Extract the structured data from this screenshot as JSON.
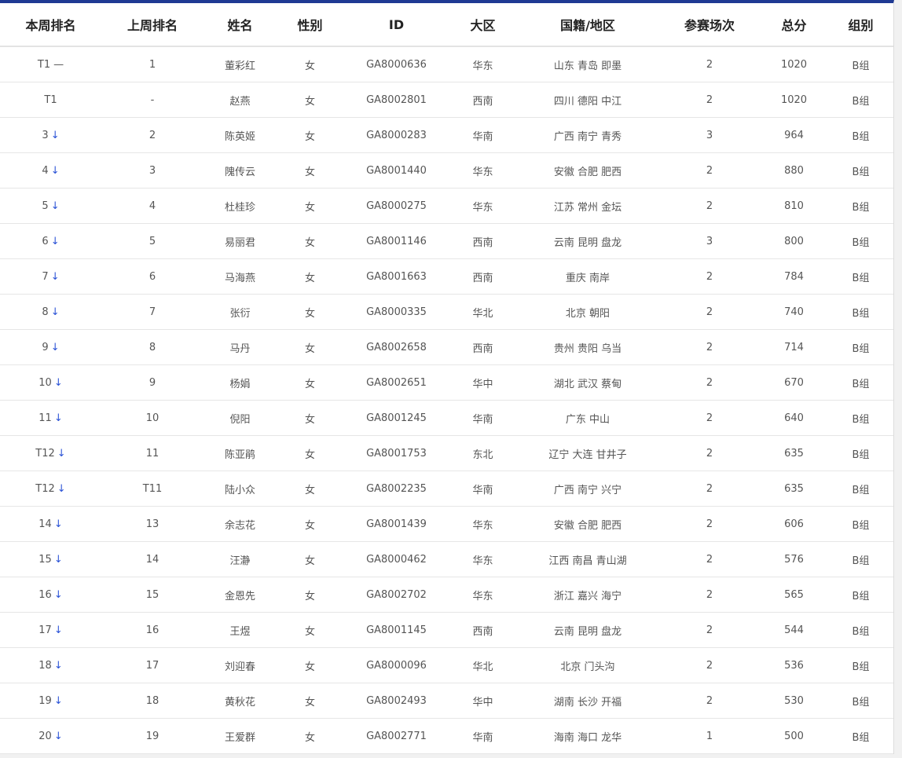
{
  "columns": [
    "本周排名",
    "上周排名",
    "姓名",
    "性别",
    "ID",
    "大区",
    "国籍/地区",
    "参赛场次",
    "总分",
    "组别"
  ],
  "rows": [
    {
      "rank": "T1",
      "trend": "—",
      "prev": "1",
      "name": "董彩红",
      "gender": "女",
      "id": "GA8000636",
      "region": "华东",
      "location": "山东 青岛 即墨",
      "games": "2",
      "score": "1020",
      "group": "B组"
    },
    {
      "rank": "T1",
      "trend": "",
      "prev": "-",
      "name": "赵燕",
      "gender": "女",
      "id": "GA8002801",
      "region": "西南",
      "location": "四川 德阳 中江",
      "games": "2",
      "score": "1020",
      "group": "B组"
    },
    {
      "rank": "3",
      "trend": "↓",
      "prev": "2",
      "name": "陈英姬",
      "gender": "女",
      "id": "GA8000283",
      "region": "华南",
      "location": "广西 南宁 青秀",
      "games": "3",
      "score": "964",
      "group": "B组"
    },
    {
      "rank": "4",
      "trend": "↓",
      "prev": "3",
      "name": "隗传云",
      "gender": "女",
      "id": "GA8001440",
      "region": "华东",
      "location": "安徽 合肥 肥西",
      "games": "2",
      "score": "880",
      "group": "B组"
    },
    {
      "rank": "5",
      "trend": "↓",
      "prev": "4",
      "name": "杜桂珍",
      "gender": "女",
      "id": "GA8000275",
      "region": "华东",
      "location": "江苏 常州 金坛",
      "games": "2",
      "score": "810",
      "group": "B组"
    },
    {
      "rank": "6",
      "trend": "↓",
      "prev": "5",
      "name": "易丽君",
      "gender": "女",
      "id": "GA8001146",
      "region": "西南",
      "location": "云南 昆明 盘龙",
      "games": "3",
      "score": "800",
      "group": "B组"
    },
    {
      "rank": "7",
      "trend": "↓",
      "prev": "6",
      "name": "马海燕",
      "gender": "女",
      "id": "GA8001663",
      "region": "西南",
      "location": "重庆 南岸",
      "games": "2",
      "score": "784",
      "group": "B组"
    },
    {
      "rank": "8",
      "trend": "↓",
      "prev": "7",
      "name": "张衍",
      "gender": "女",
      "id": "GA8000335",
      "region": "华北",
      "location": "北京 朝阳",
      "games": "2",
      "score": "740",
      "group": "B组"
    },
    {
      "rank": "9",
      "trend": "↓",
      "prev": "8",
      "name": "马丹",
      "gender": "女",
      "id": "GA8002658",
      "region": "西南",
      "location": "贵州 贵阳 乌当",
      "games": "2",
      "score": "714",
      "group": "B组"
    },
    {
      "rank": "10",
      "trend": "↓",
      "prev": "9",
      "name": "杨娟",
      "gender": "女",
      "id": "GA8002651",
      "region": "华中",
      "location": "湖北 武汉 蔡甸",
      "games": "2",
      "score": "670",
      "group": "B组"
    },
    {
      "rank": "11",
      "trend": "↓",
      "prev": "10",
      "name": "倪阳",
      "gender": "女",
      "id": "GA8001245",
      "region": "华南",
      "location": "广东 中山",
      "games": "2",
      "score": "640",
      "group": "B组"
    },
    {
      "rank": "T12",
      "trend": "↓",
      "prev": "11",
      "name": "陈亚鹃",
      "gender": "女",
      "id": "GA8001753",
      "region": "东北",
      "location": "辽宁 大连 甘井子",
      "games": "2",
      "score": "635",
      "group": "B组"
    },
    {
      "rank": "T12",
      "trend": "↓",
      "prev": "T11",
      "name": "陆小众",
      "gender": "女",
      "id": "GA8002235",
      "region": "华南",
      "location": "广西 南宁 兴宁",
      "games": "2",
      "score": "635",
      "group": "B组"
    },
    {
      "rank": "14",
      "trend": "↓",
      "prev": "13",
      "name": "余志花",
      "gender": "女",
      "id": "GA8001439",
      "region": "华东",
      "location": "安徽 合肥 肥西",
      "games": "2",
      "score": "606",
      "group": "B组"
    },
    {
      "rank": "15",
      "trend": "↓",
      "prev": "14",
      "name": "汪瀞",
      "gender": "女",
      "id": "GA8000462",
      "region": "华东",
      "location": "江西 南昌 青山湖",
      "games": "2",
      "score": "576",
      "group": "B组"
    },
    {
      "rank": "16",
      "trend": "↓",
      "prev": "15",
      "name": "金恩先",
      "gender": "女",
      "id": "GA8002702",
      "region": "华东",
      "location": "浙江 嘉兴 海宁",
      "games": "2",
      "score": "565",
      "group": "B组"
    },
    {
      "rank": "17",
      "trend": "↓",
      "prev": "16",
      "name": "王煜",
      "gender": "女",
      "id": "GA8001145",
      "region": "西南",
      "location": "云南 昆明 盘龙",
      "games": "2",
      "score": "544",
      "group": "B组"
    },
    {
      "rank": "18",
      "trend": "↓",
      "prev": "17",
      "name": "刘迎春",
      "gender": "女",
      "id": "GA8000096",
      "region": "华北",
      "location": "北京 门头沟",
      "games": "2",
      "score": "536",
      "group": "B组"
    },
    {
      "rank": "19",
      "trend": "↓",
      "prev": "18",
      "name": "黄秋花",
      "gender": "女",
      "id": "GA8002493",
      "region": "华中",
      "location": "湖南 长沙 开福",
      "games": "2",
      "score": "530",
      "group": "B组"
    },
    {
      "rank": "20",
      "trend": "↓",
      "prev": "19",
      "name": "王爱群",
      "gender": "女",
      "id": "GA8002771",
      "region": "华南",
      "location": "海南 海口 龙华",
      "games": "1",
      "score": "500",
      "group": "B组"
    }
  ],
  "colors": {
    "accent_bar": "#1f3a93",
    "arrow": "#2a52d6"
  }
}
